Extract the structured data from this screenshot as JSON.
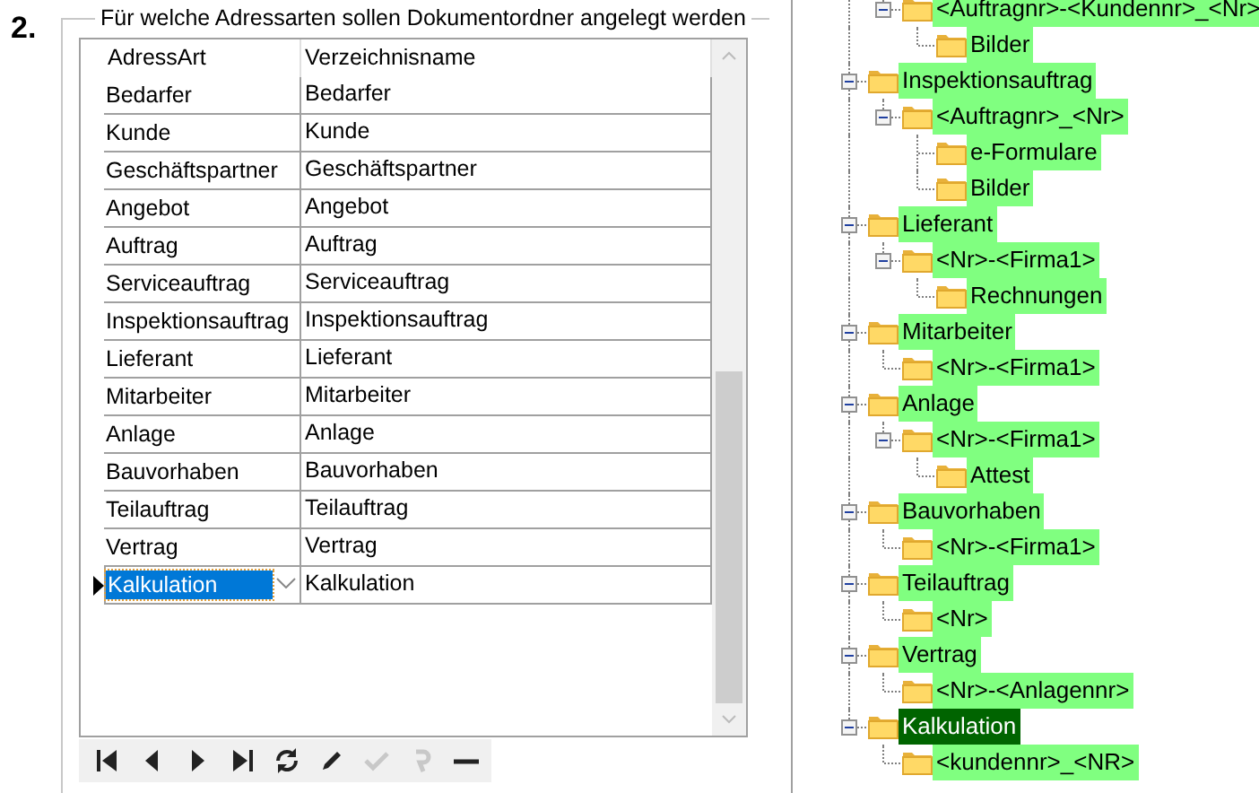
{
  "step": "2.",
  "group": {
    "legend": "Für welche Adressarten sollen Dokumentordner angelegt werden"
  },
  "grid": {
    "columns": [
      "AdressArt",
      "Verzeichnisname"
    ],
    "rows": [
      {
        "adressart": "Bedarfer",
        "verzeichnisname": "Bedarfer",
        "selected": false
      },
      {
        "adressart": "Kunde",
        "verzeichnisname": "Kunde",
        "selected": false
      },
      {
        "adressart": "Geschäftspartner",
        "verzeichnisname": "Geschäftspartner",
        "selected": false
      },
      {
        "adressart": "Angebot",
        "verzeichnisname": "Angebot",
        "selected": false
      },
      {
        "adressart": "Auftrag",
        "verzeichnisname": "Auftrag",
        "selected": false
      },
      {
        "adressart": "Serviceauftrag",
        "verzeichnisname": "Serviceauftrag",
        "selected": false
      },
      {
        "adressart": "Inspektionsauftrag",
        "verzeichnisname": "Inspektionsauftrag",
        "selected": false
      },
      {
        "adressart": "Lieferant",
        "verzeichnisname": "Lieferant",
        "selected": false
      },
      {
        "adressart": "Mitarbeiter",
        "verzeichnisname": "Mitarbeiter",
        "selected": false
      },
      {
        "adressart": "Anlage",
        "verzeichnisname": "Anlage",
        "selected": false
      },
      {
        "adressart": "Bauvorhaben",
        "verzeichnisname": "Bauvorhaben",
        "selected": false
      },
      {
        "adressart": "Teilauftrag",
        "verzeichnisname": "Teilauftrag",
        "selected": false
      },
      {
        "adressart": "Vertrag",
        "verzeichnisname": "Vertrag",
        "selected": false
      },
      {
        "adressart": "Kalkulation",
        "verzeichnisname": "Kalkulation",
        "selected": true
      }
    ]
  },
  "navigator": [
    {
      "kind": "first",
      "disabled": false
    },
    {
      "kind": "prev",
      "disabled": false
    },
    {
      "kind": "next",
      "disabled": false
    },
    {
      "kind": "last",
      "disabled": false
    },
    {
      "kind": "refresh",
      "disabled": false
    },
    {
      "kind": "edit",
      "disabled": false
    },
    {
      "kind": "post",
      "disabled": true
    },
    {
      "kind": "cancel",
      "disabled": true
    },
    {
      "kind": "delete",
      "disabled": false
    }
  ],
  "tree": {
    "continued_branch": [
      {
        "label": "<Auftragnr>-<Kundennr>_<Nr>",
        "selected": false,
        "expanded": true,
        "children": [
          {
            "label": "Bilder",
            "selected": false
          }
        ]
      }
    ],
    "nodes": [
      {
        "label": "Inspektionsauftrag",
        "selected": false,
        "expanded": true,
        "children": [
          {
            "label": "<Auftragnr>_<Nr>",
            "selected": false,
            "expanded": true,
            "children": [
              {
                "label": "e-Formulare",
                "selected": false
              },
              {
                "label": "Bilder",
                "selected": false
              }
            ]
          }
        ]
      },
      {
        "label": "Lieferant",
        "selected": false,
        "expanded": true,
        "children": [
          {
            "label": "<Nr>-<Firma1>",
            "selected": false,
            "expanded": true,
            "children": [
              {
                "label": "Rechnungen",
                "selected": false
              }
            ]
          }
        ]
      },
      {
        "label": "Mitarbeiter",
        "selected": false,
        "expanded": true,
        "children": [
          {
            "label": "<Nr>-<Firma1>",
            "selected": false
          }
        ]
      },
      {
        "label": "Anlage",
        "selected": false,
        "expanded": true,
        "children": [
          {
            "label": "<Nr>-<Firma1>",
            "selected": false,
            "expanded": true,
            "children": [
              {
                "label": "Attest",
                "selected": false
              }
            ]
          }
        ]
      },
      {
        "label": "Bauvorhaben",
        "selected": false,
        "expanded": true,
        "children": [
          {
            "label": "<Nr>-<Firma1>",
            "selected": false
          }
        ]
      },
      {
        "label": "Teilauftrag",
        "selected": false,
        "expanded": true,
        "children": [
          {
            "label": "<Nr>",
            "selected": false
          }
        ]
      },
      {
        "label": "Vertrag",
        "selected": false,
        "expanded": true,
        "children": [
          {
            "label": "<Nr>-<Anlagennr>",
            "selected": false
          }
        ]
      },
      {
        "label": "Kalkulation",
        "selected": true,
        "expanded": true,
        "children": [
          {
            "label": "<kundennr>_<NR>",
            "selected": false
          }
        ]
      }
    ]
  }
}
